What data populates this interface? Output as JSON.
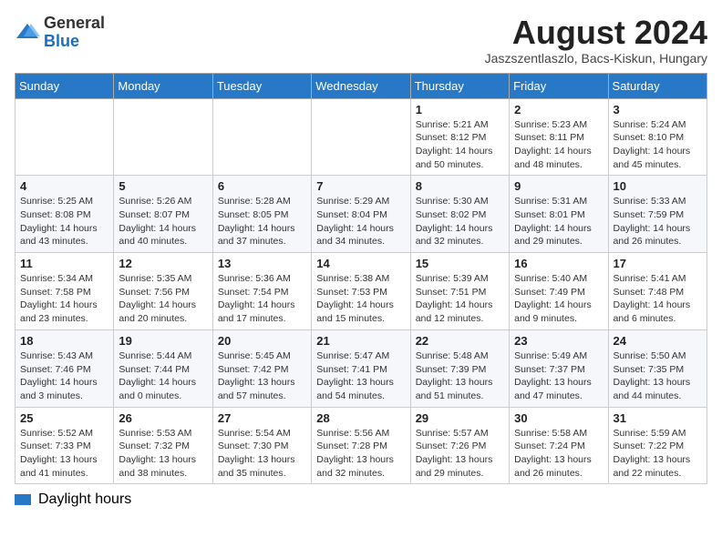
{
  "header": {
    "logo_general": "General",
    "logo_blue": "Blue",
    "month_title": "August 2024",
    "subtitle": "Jaszszentlaszlo, Bacs-Kiskun, Hungary"
  },
  "weekdays": [
    "Sunday",
    "Monday",
    "Tuesday",
    "Wednesday",
    "Thursday",
    "Friday",
    "Saturday"
  ],
  "weeks": [
    [
      {
        "day": "",
        "detail": ""
      },
      {
        "day": "",
        "detail": ""
      },
      {
        "day": "",
        "detail": ""
      },
      {
        "day": "",
        "detail": ""
      },
      {
        "day": "1",
        "detail": "Sunrise: 5:21 AM\nSunset: 8:12 PM\nDaylight: 14 hours and 50 minutes."
      },
      {
        "day": "2",
        "detail": "Sunrise: 5:23 AM\nSunset: 8:11 PM\nDaylight: 14 hours and 48 minutes."
      },
      {
        "day": "3",
        "detail": "Sunrise: 5:24 AM\nSunset: 8:10 PM\nDaylight: 14 hours and 45 minutes."
      }
    ],
    [
      {
        "day": "4",
        "detail": "Sunrise: 5:25 AM\nSunset: 8:08 PM\nDaylight: 14 hours and 43 minutes."
      },
      {
        "day": "5",
        "detail": "Sunrise: 5:26 AM\nSunset: 8:07 PM\nDaylight: 14 hours and 40 minutes."
      },
      {
        "day": "6",
        "detail": "Sunrise: 5:28 AM\nSunset: 8:05 PM\nDaylight: 14 hours and 37 minutes."
      },
      {
        "day": "7",
        "detail": "Sunrise: 5:29 AM\nSunset: 8:04 PM\nDaylight: 14 hours and 34 minutes."
      },
      {
        "day": "8",
        "detail": "Sunrise: 5:30 AM\nSunset: 8:02 PM\nDaylight: 14 hours and 32 minutes."
      },
      {
        "day": "9",
        "detail": "Sunrise: 5:31 AM\nSunset: 8:01 PM\nDaylight: 14 hours and 29 minutes."
      },
      {
        "day": "10",
        "detail": "Sunrise: 5:33 AM\nSunset: 7:59 PM\nDaylight: 14 hours and 26 minutes."
      }
    ],
    [
      {
        "day": "11",
        "detail": "Sunrise: 5:34 AM\nSunset: 7:58 PM\nDaylight: 14 hours and 23 minutes."
      },
      {
        "day": "12",
        "detail": "Sunrise: 5:35 AM\nSunset: 7:56 PM\nDaylight: 14 hours and 20 minutes."
      },
      {
        "day": "13",
        "detail": "Sunrise: 5:36 AM\nSunset: 7:54 PM\nDaylight: 14 hours and 17 minutes."
      },
      {
        "day": "14",
        "detail": "Sunrise: 5:38 AM\nSunset: 7:53 PM\nDaylight: 14 hours and 15 minutes."
      },
      {
        "day": "15",
        "detail": "Sunrise: 5:39 AM\nSunset: 7:51 PM\nDaylight: 14 hours and 12 minutes."
      },
      {
        "day": "16",
        "detail": "Sunrise: 5:40 AM\nSunset: 7:49 PM\nDaylight: 14 hours and 9 minutes."
      },
      {
        "day": "17",
        "detail": "Sunrise: 5:41 AM\nSunset: 7:48 PM\nDaylight: 14 hours and 6 minutes."
      }
    ],
    [
      {
        "day": "18",
        "detail": "Sunrise: 5:43 AM\nSunset: 7:46 PM\nDaylight: 14 hours and 3 minutes."
      },
      {
        "day": "19",
        "detail": "Sunrise: 5:44 AM\nSunset: 7:44 PM\nDaylight: 14 hours and 0 minutes."
      },
      {
        "day": "20",
        "detail": "Sunrise: 5:45 AM\nSunset: 7:42 PM\nDaylight: 13 hours and 57 minutes."
      },
      {
        "day": "21",
        "detail": "Sunrise: 5:47 AM\nSunset: 7:41 PM\nDaylight: 13 hours and 54 minutes."
      },
      {
        "day": "22",
        "detail": "Sunrise: 5:48 AM\nSunset: 7:39 PM\nDaylight: 13 hours and 51 minutes."
      },
      {
        "day": "23",
        "detail": "Sunrise: 5:49 AM\nSunset: 7:37 PM\nDaylight: 13 hours and 47 minutes."
      },
      {
        "day": "24",
        "detail": "Sunrise: 5:50 AM\nSunset: 7:35 PM\nDaylight: 13 hours and 44 minutes."
      }
    ],
    [
      {
        "day": "25",
        "detail": "Sunrise: 5:52 AM\nSunset: 7:33 PM\nDaylight: 13 hours and 41 minutes."
      },
      {
        "day": "26",
        "detail": "Sunrise: 5:53 AM\nSunset: 7:32 PM\nDaylight: 13 hours and 38 minutes."
      },
      {
        "day": "27",
        "detail": "Sunrise: 5:54 AM\nSunset: 7:30 PM\nDaylight: 13 hours and 35 minutes."
      },
      {
        "day": "28",
        "detail": "Sunrise: 5:56 AM\nSunset: 7:28 PM\nDaylight: 13 hours and 32 minutes."
      },
      {
        "day": "29",
        "detail": "Sunrise: 5:57 AM\nSunset: 7:26 PM\nDaylight: 13 hours and 29 minutes."
      },
      {
        "day": "30",
        "detail": "Sunrise: 5:58 AM\nSunset: 7:24 PM\nDaylight: 13 hours and 26 minutes."
      },
      {
        "day": "31",
        "detail": "Sunrise: 5:59 AM\nSunset: 7:22 PM\nDaylight: 13 hours and 22 minutes."
      }
    ]
  ],
  "legend": {
    "daylight_label": "Daylight hours"
  }
}
